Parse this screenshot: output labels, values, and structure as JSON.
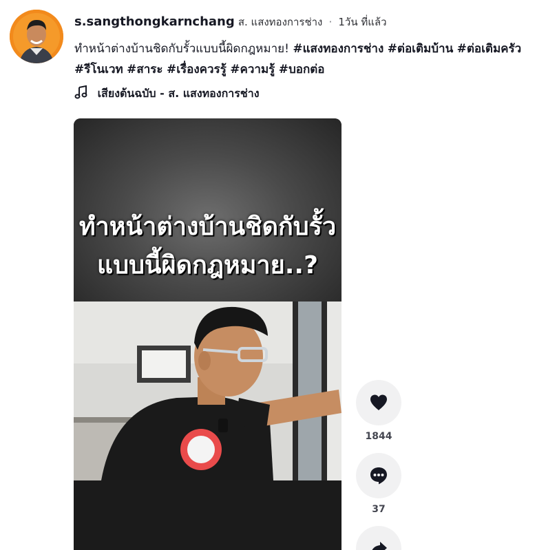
{
  "author": {
    "username": "s.sangthongkarnchang",
    "nickname": "ส. แสงทองการช่าง",
    "separator": "·",
    "posted_time": "1วัน ที่แล้ว"
  },
  "caption": {
    "text": "ทำหน้าต่างบ้านชิดกับรั้วแบบนี้ผิดกฎหมาย!",
    "hashtags": [
      "#แสงทองการช่าง",
      "#ต่อเติมบ้าน",
      "#ต่อเติมครัว",
      "#รีโนเวท",
      "#สาระ",
      "#เรื่องควรรู้",
      "#ความรู้",
      "#บอกต่อ"
    ]
  },
  "music": {
    "icon": "music-note-icon",
    "label": "เสียงต้นฉบับ - ส. แสงทองการช่าง"
  },
  "video": {
    "overlay_line1": "ทำหน้าต่างบ้านชิดกับรั้ว",
    "overlay_line2": "แบบนี้ผิดกฎหมาย..?"
  },
  "actions": {
    "like": {
      "icon": "heart-icon",
      "count": "1844"
    },
    "comment": {
      "icon": "comment-icon",
      "count": "37"
    },
    "share": {
      "icon": "share-icon"
    }
  },
  "colors": {
    "text": "#161823",
    "action_bg": "#f1f1f2",
    "avatar_bg": "#f28a1c"
  }
}
